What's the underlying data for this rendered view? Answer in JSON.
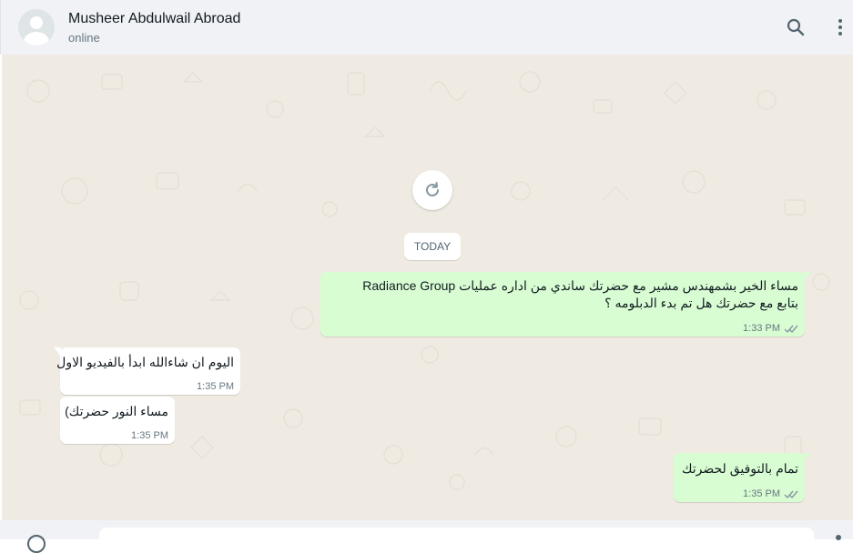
{
  "header": {
    "contact_name": "Musheer Abdulwail Abroad",
    "status": "online",
    "icons": [
      "avatar-icon",
      "search-icon",
      "more-vertical-icon"
    ]
  },
  "chat": {
    "date_chip": "TODAY",
    "messages": [
      {
        "direction": "outgoing",
        "lines": [
          "مساء الخير بشمهندس مشير مع حضرتك ساندي من اداره عمليات Radiance Group",
          "بتابع مع حضرتك هل تم بدء الدبلومه ؟"
        ],
        "time": "1:33 PM",
        "status": "read"
      },
      {
        "direction": "incoming",
        "lines": [
          "اليوم ان شاءالله ابدأ بالفيديو الاول"
        ],
        "time": "1:35 PM"
      },
      {
        "direction": "incoming",
        "lines": [
          "مساء النور حضرتك)"
        ],
        "time": "1:35 PM"
      },
      {
        "direction": "outgoing",
        "lines": [
          "تمام بالتوفيق لحضرتك"
        ],
        "time": "1:35 PM",
        "status": "read"
      }
    ]
  },
  "colors": {
    "header_bg": "#f0f2f5",
    "chat_bg": "#efeae2",
    "outgoing_bubble": "#d9fdd3",
    "incoming_bubble": "#ffffff",
    "read_ticks": "#8696a0"
  }
}
